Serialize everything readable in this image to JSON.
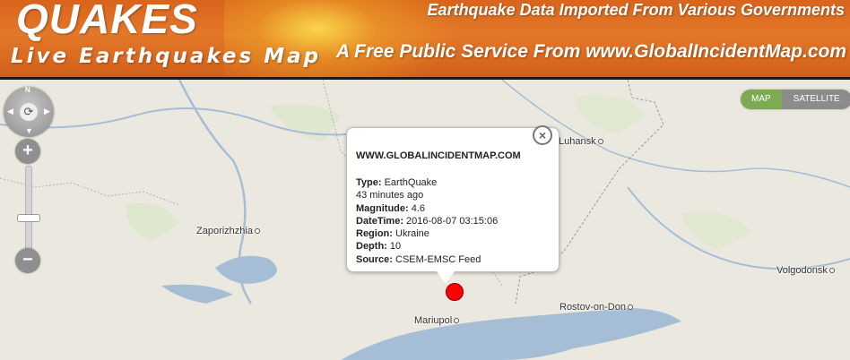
{
  "header": {
    "title": "QUAKES",
    "subtitle": "Live Earthquakes Map",
    "tagline1": "Earthquake Data Imported From Various Governments",
    "tagline2": "A Free Public Service From www.GlobalIncidentMap.com"
  },
  "map_controls": {
    "compass_north": "N",
    "center_icon": "⟳",
    "zoom_in": "+",
    "zoom_out": "−",
    "map_button": "MAP",
    "satellite_button": "SATELLITE"
  },
  "cities": [
    {
      "name": "Luhansk"
    },
    {
      "name": "Zaporizhzhia"
    },
    {
      "name": "Volgodonsk"
    },
    {
      "name": "Rostov-on-Don"
    },
    {
      "name": "Mariupol"
    }
  ],
  "popup": {
    "site": "WWW.GLOBALINCIDENTMAP.COM",
    "close_icon": "×",
    "fields": [
      {
        "label": "Type:",
        "value": "EarthQuake"
      },
      {
        "label": "",
        "value": "43 minutes ago"
      },
      {
        "label": "Magnitude:",
        "value": "4.6"
      },
      {
        "label": "DateTime:",
        "value": "2016-08-07 03:15:06"
      },
      {
        "label": "Region:",
        "value": "Ukraine"
      },
      {
        "label": "Depth:",
        "value": "10"
      },
      {
        "label": "Source:",
        "value": "CSEM-EMSC Feed"
      }
    ]
  },
  "colors": {
    "header_orange": "#d9641c",
    "marker_red": "#ff0000",
    "map_button_green": "#7daa52",
    "water": "#a6bdd6"
  }
}
